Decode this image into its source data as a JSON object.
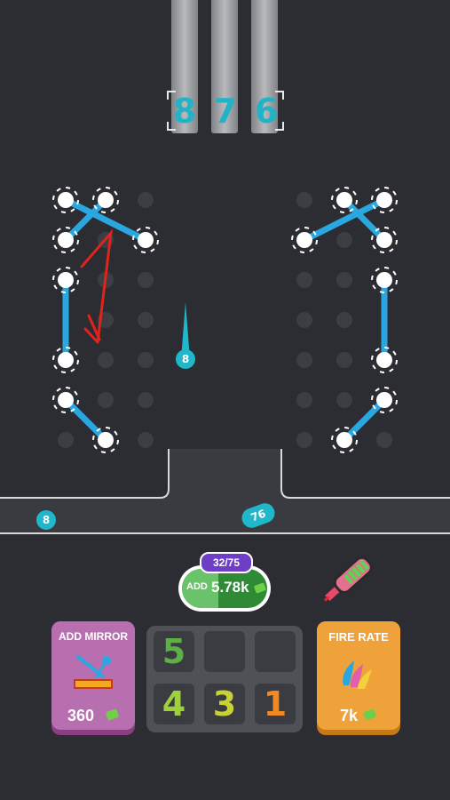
{
  "counters": [
    "8",
    "7",
    "6"
  ],
  "flying_balls": [
    {
      "label": "8"
    },
    {
      "label": "8"
    },
    {
      "label": "76"
    }
  ],
  "add_button": {
    "progress": "32/75",
    "label": "ADD",
    "cost": "5.78k"
  },
  "add_mirror": {
    "title": "ADD MIRROR",
    "cost": "360"
  },
  "fire_rate": {
    "title": "FIRE RATE",
    "cost": "7k"
  },
  "merge_grid": {
    "slots": [
      "5",
      "",
      "",
      "4",
      "3",
      "1"
    ]
  },
  "colors": {
    "background": "#2c2d32",
    "ball": "#1fb7c9",
    "mirror": "#2aa7e0",
    "add_mirror_card": "#b86fb0",
    "fire_rate_card": "#f0a23a",
    "add_button": "#4f9a3f"
  },
  "icons": [
    "cash-icon",
    "mirror-icon",
    "paint-drops-icon",
    "laser-gun-icon"
  ]
}
